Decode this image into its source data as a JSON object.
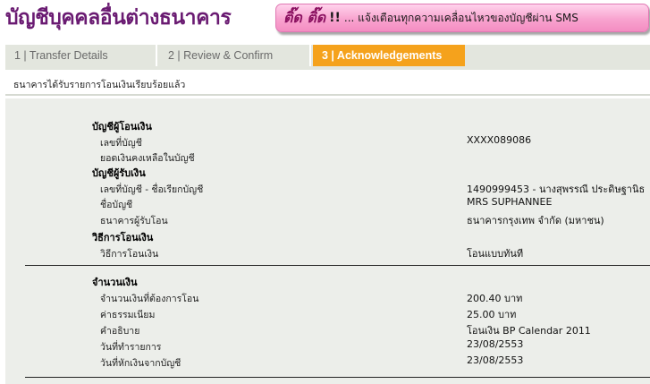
{
  "header": {
    "title": "บัญชีบุคคลอื่นต่างธนาคาร",
    "sms_banner": {
      "brand": "ติ๊ด ติ๊ด",
      "bang": "!!",
      "text": "... แจ้งเตือนทุกความเคลื่อนไหวของบัญชีผ่าน SMS"
    }
  },
  "tabs": [
    {
      "label": "1 | Transfer Details",
      "active": false
    },
    {
      "label": "2 | Review & Confirm",
      "active": false
    },
    {
      "label": "3 | Acknowledgements",
      "active": true
    }
  ],
  "status_message": "ธนาคารได้รับรายการโอนเงินเรียบร้อยแล้ว",
  "sections": {
    "from_account": {
      "heading": "บัญชีผู้โอนเงิน",
      "rows": [
        {
          "label": "เลขที่บัญชี",
          "value": "XXXX089086"
        },
        {
          "label": "ยอดเงินคงเหลือในบัญชี",
          "value": ""
        }
      ]
    },
    "to_account": {
      "heading": "บัญชีผู้รับเงิน",
      "rows": [
        {
          "label": "เลขที่บัญชี - ชื่อเรียกบัญชี",
          "value": "1490999453 - นางสุพรรณี ประดิษฐานิธ"
        },
        {
          "label": "ชื่อบัญชี",
          "value": "MRS SUPHANNEE"
        },
        {
          "label": "ธนาคารผู้รับโอน",
          "value": "ธนาคารกรุงเทพ จำกัด (มหาชน)"
        }
      ]
    },
    "method": {
      "heading": "วิธีการโอนเงิน",
      "rows": [
        {
          "label": "วิธีการโอนเงิน",
          "value": "โอนแบบทันที"
        }
      ]
    },
    "amount": {
      "heading": "จำนวนเงิน",
      "rows": [
        {
          "label": "จำนวนเงินที่ต้องการโอน",
          "value": "200.40 บาท"
        },
        {
          "label": "ค่าธรรมเนียม",
          "value": "25.00  บาท"
        },
        {
          "label": "คำอธิบาย",
          "value": "โอนเงิน BP Calendar 2011"
        },
        {
          "label": "วันที่ทำรายการ",
          "value": "23/08/2553"
        },
        {
          "label": "วันที่หักเงินจากบัญชี",
          "value": "23/08/2553"
        }
      ]
    }
  },
  "colors": {
    "title_purple": "#6a1b72",
    "active_tab": "#f5a21c",
    "tab_bg": "#e3e6de",
    "panel_bg": "#eceeea",
    "banner_pink": "#f8a3cf"
  }
}
